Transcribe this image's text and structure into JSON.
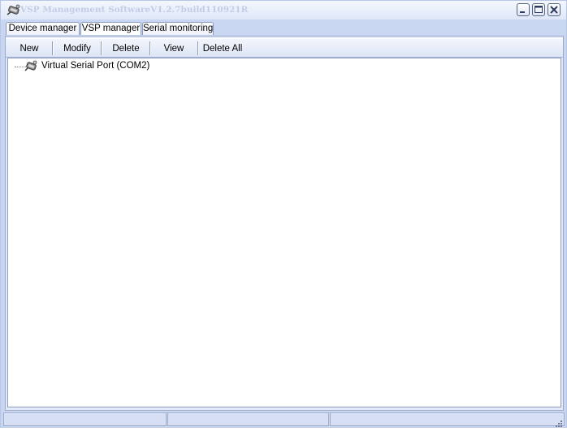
{
  "window": {
    "title": "VSP Management SoftwareV1.2.7build110921R",
    "icon": "serial-port-icon",
    "controls": [
      "minimize-icon",
      "maximize-icon",
      "close-icon"
    ]
  },
  "tabs": [
    {
      "label": "Device manager",
      "active": false
    },
    {
      "label": "VSP manager",
      "active": true
    },
    {
      "label": "Serial monitoring",
      "active": false
    }
  ],
  "toolbar": {
    "new_label": "New",
    "modify_label": "Modify",
    "delete_label": "Delete",
    "view_label": "View",
    "delete_all_label": "Delete All"
  },
  "tree": {
    "items": [
      {
        "label": "Virtual Serial Port (COM2)",
        "icon": "serial-port-icon"
      }
    ]
  },
  "statusbar": {
    "panes": [
      "",
      "",
      ""
    ]
  },
  "colors": {
    "frame": "#c9d6f1",
    "title_text": "#c3cde8",
    "content_bg": "#ffffff"
  }
}
